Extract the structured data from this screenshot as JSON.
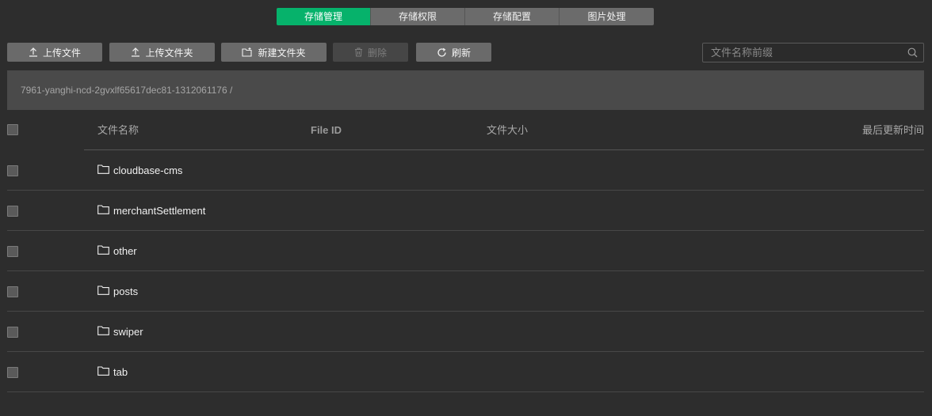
{
  "tabs": [
    {
      "label": "存储管理",
      "active": true
    },
    {
      "label": "存储权限",
      "active": false
    },
    {
      "label": "存储配置",
      "active": false
    },
    {
      "label": "图片处理",
      "active": false
    }
  ],
  "toolbar": {
    "upload_file": "上传文件",
    "upload_folder": "上传文件夹",
    "new_folder": "新建文件夹",
    "delete": "删除",
    "refresh": "刷新"
  },
  "search": {
    "placeholder": "文件名称前缀"
  },
  "path": "7961-yanghi-ncd-2gvxlf65617dec81-1312061176  /",
  "table": {
    "columns": {
      "name": "文件名称",
      "file_id": "File ID",
      "size": "文件大小",
      "updated": "最后更新时间"
    },
    "rows": [
      {
        "name": "cloudbase-cms"
      },
      {
        "name": "merchantSettlement"
      },
      {
        "name": "other"
      },
      {
        "name": "posts"
      },
      {
        "name": "swiper"
      },
      {
        "name": "tab"
      }
    ]
  },
  "colors": {
    "accent": "#06b26b",
    "background": "#2d2d2d",
    "button": "#6a6a6a"
  },
  "icons": {
    "upload": "upload-icon",
    "new_folder": "new-folder-icon",
    "delete": "trash-icon",
    "refresh": "refresh-icon",
    "search": "search-icon",
    "folder": "folder-icon"
  }
}
